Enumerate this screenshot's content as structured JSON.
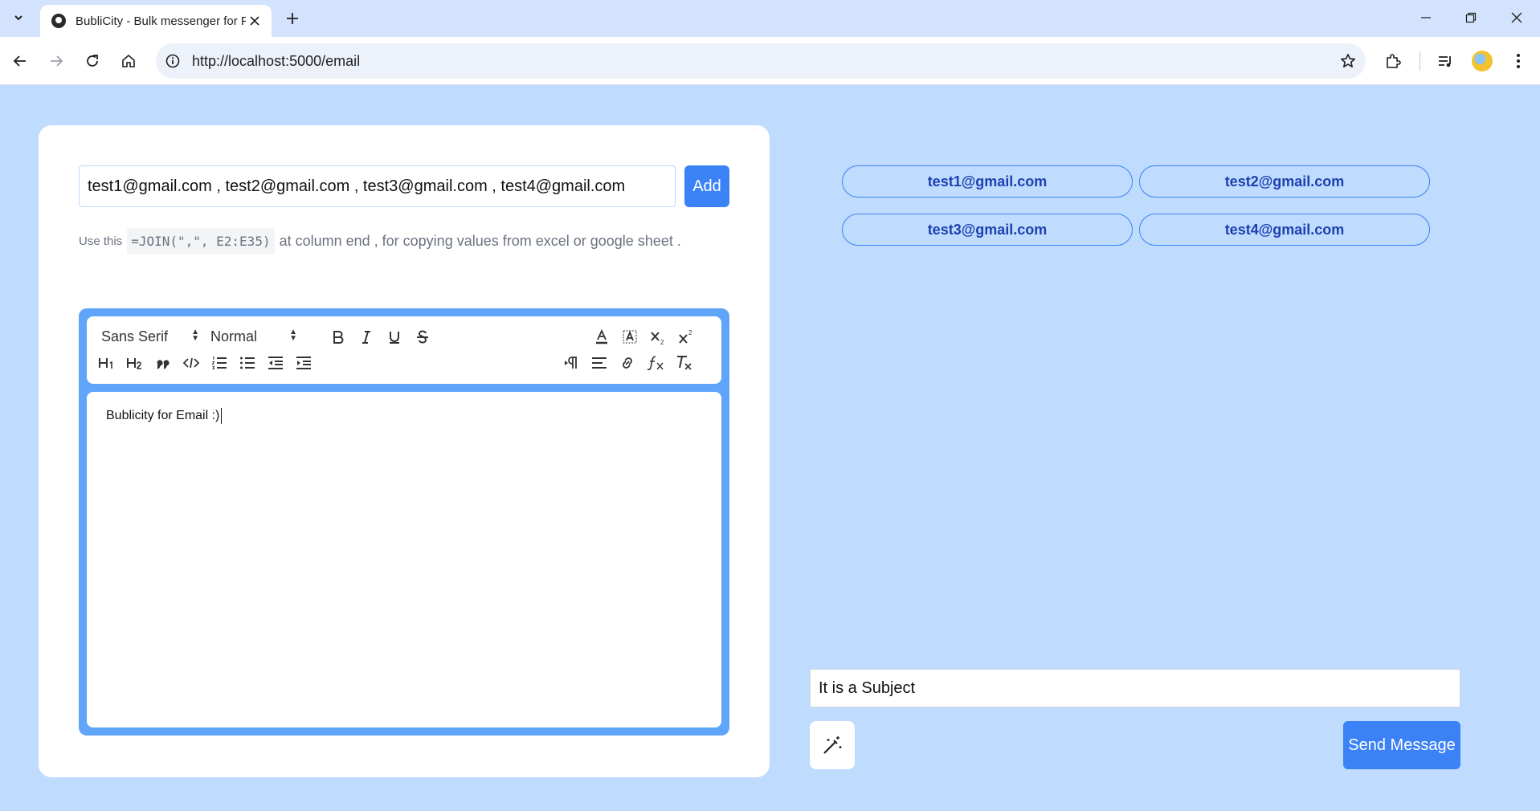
{
  "browser": {
    "tab_title": "BubliCity - Bulk messenger for F",
    "url": "http://localhost:5000/email",
    "tab_icons": {
      "tab_search": "chevron-down-icon",
      "close": "close-icon",
      "new_tab": "plus-icon"
    },
    "window_controls": [
      "minimize-icon",
      "restore-icon",
      "close-icon"
    ]
  },
  "form": {
    "emails_input_value": "test1@gmail.com , test2@gmail.com , test3@gmail.com , test4@gmail.com",
    "add_label": "Add",
    "hint_prefix": "Use this",
    "hint_code": "=JOIN(\",\", E2:E35)",
    "hint_suffix": "at column end , for copying values from excel or google sheet ."
  },
  "editor": {
    "font_select": "Sans Serif",
    "size_select": "Normal",
    "content": "Bublicity for Email :)"
  },
  "recipients": [
    "test1@gmail.com",
    "test2@gmail.com",
    "test3@gmail.com",
    "test4@gmail.com"
  ],
  "compose": {
    "subject_value": "It is a Subject",
    "send_label": "Send Message",
    "magic_icon": "magic-wand-icon"
  },
  "colors": {
    "page_bg": "#bfdbfe",
    "accent": "#3b82f6",
    "editor_frame": "#60a5fa",
    "chip_text": "#1e40af"
  }
}
